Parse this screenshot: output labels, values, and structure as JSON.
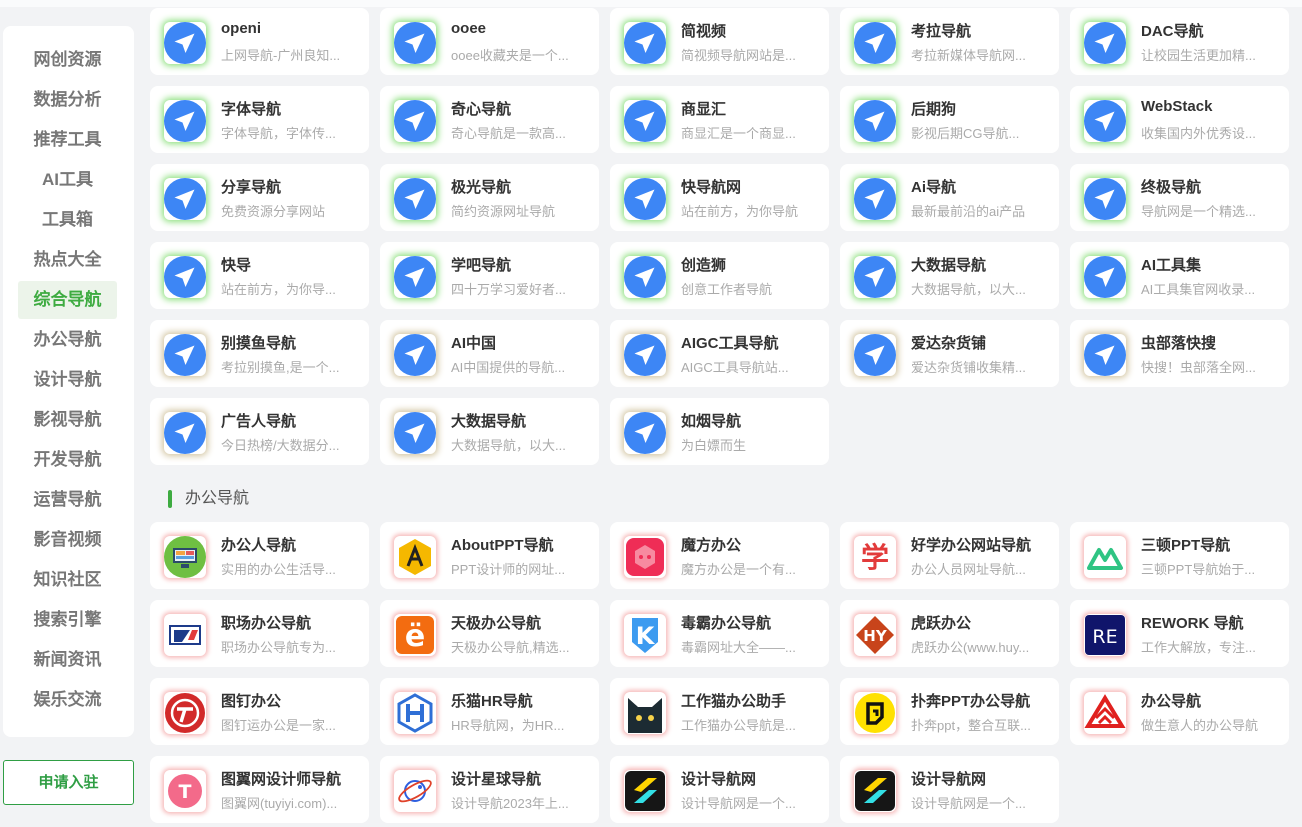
{
  "sidebar": {
    "items": [
      "网创资源",
      "数据分析",
      "推荐工具",
      "AI工具",
      "工具箱",
      "热点大全",
      "综合导航",
      "办公导航",
      "设计导航",
      "影视导航",
      "开发导航",
      "运营导航",
      "影音视频",
      "知识社区",
      "搜索引擎",
      "新闻资讯",
      "娱乐交流"
    ],
    "active": "综合导航",
    "apply_label": "申请入驻"
  },
  "general_nav": {
    "sites": [
      {
        "title": "openi",
        "desc": "上网导航-广州良知...",
        "glow": "green"
      },
      {
        "title": "ooee",
        "desc": "ooee收藏夹是一个...",
        "glow": "green"
      },
      {
        "title": "简视频",
        "desc": "简视频导航网站是...",
        "glow": "green"
      },
      {
        "title": "考拉导航",
        "desc": "考拉新媒体导航网...",
        "glow": "green"
      },
      {
        "title": "DAC导航",
        "desc": "让校园生活更加精...",
        "glow": "green"
      },
      {
        "title": "字体导航",
        "desc": "字体导航，字体传...",
        "glow": "green"
      },
      {
        "title": "奇心导航",
        "desc": "奇心导航是一款高...",
        "glow": "green"
      },
      {
        "title": "商显汇",
        "desc": "商显汇是一个商显...",
        "glow": "green"
      },
      {
        "title": "后期狗",
        "desc": "影视后期CG导航...",
        "glow": "green"
      },
      {
        "title": "WebStack",
        "desc": "收集国内外优秀设...",
        "glow": "green"
      },
      {
        "title": "分享导航",
        "desc": "免费资源分享网站",
        "glow": "green"
      },
      {
        "title": "极光导航",
        "desc": "简约资源网址导航",
        "glow": "green"
      },
      {
        "title": "快导航网",
        "desc": "站在前方，为你导航",
        "glow": "green"
      },
      {
        "title": "Ai导航",
        "desc": "最新最前沿的ai产品",
        "glow": "green"
      },
      {
        "title": "终极导航",
        "desc": "导航网是一个精选...",
        "glow": "green"
      },
      {
        "title": "快导",
        "desc": "站在前方，为你导...",
        "glow": "green"
      },
      {
        "title": "学吧导航",
        "desc": "四十万学习爱好者...",
        "glow": "green"
      },
      {
        "title": "创造狮",
        "desc": "创意工作者导航",
        "glow": "green"
      },
      {
        "title": "大数据导航",
        "desc": "大数据导航，以大...",
        "glow": "green"
      },
      {
        "title": "AI工具集",
        "desc": "AI工具集官网收录...",
        "glow": "green"
      },
      {
        "title": "别摸鱼导航",
        "desc": "考拉别摸鱼,是一个...",
        "glow": "gold"
      },
      {
        "title": "AI中国",
        "desc": "AI中国提供的导航...",
        "glow": "gold"
      },
      {
        "title": "AIGC工具导航",
        "desc": "AIGC工具导航站...",
        "glow": "gold"
      },
      {
        "title": "爱达杂货铺",
        "desc": "爱达杂货铺收集精...",
        "glow": "gold"
      },
      {
        "title": "虫部落快搜",
        "desc": "快搜！虫部落全网...",
        "glow": "gold"
      },
      {
        "title": "广告人导航",
        "desc": "今日热榜/大数据分...",
        "glow": "gold"
      },
      {
        "title": "大数据导航",
        "desc": "大数据导航，以大...",
        "glow": "gold"
      },
      {
        "title": "如烟导航",
        "desc": "为白嫖而生",
        "glow": "gold"
      }
    ]
  },
  "office_nav": {
    "heading": "办公导航",
    "sites": [
      {
        "title": "办公人导航",
        "desc": "实用的办公生活导...",
        "icon": "monitor-icon"
      },
      {
        "title": "AboutPPT导航",
        "desc": "PPT设计师的网址...",
        "icon": "aboutppt-logo-icon"
      },
      {
        "title": "魔方办公",
        "desc": "魔方办公是一个有...",
        "icon": "mofang-logo-icon"
      },
      {
        "title": "好学办公网站导航",
        "desc": "办公人员网址导航...",
        "icon": "xue-logo-icon",
        "logo_text": "学"
      },
      {
        "title": "三顿PPT导航",
        "desc": "三顿PPT导航始于...",
        "icon": "sandun-logo-icon"
      },
      {
        "title": "职场办公导航",
        "desc": "职场办公导航专为...",
        "icon": "zhichang-logo-icon"
      },
      {
        "title": "天极办公导航",
        "desc": "天极办公导航,精选...",
        "icon": "tianji-logo-icon",
        "logo_text": "ë"
      },
      {
        "title": "毒霸办公导航",
        "desc": "毒霸网址大全——...",
        "icon": "duba-logo-icon",
        "logo_text": "K"
      },
      {
        "title": "虎跃办公",
        "desc": "虎跃办公(www.huy...",
        "icon": "huyue-logo-icon",
        "logo_text": "HY"
      },
      {
        "title": "REWORK 导航",
        "desc": "工作大解放，专注...",
        "icon": "rework-logo-icon",
        "logo_text": "RE"
      },
      {
        "title": "图钉办公",
        "desc": "图钉运办公是一家...",
        "icon": "tuding-logo-icon"
      },
      {
        "title": "乐猫HR导航",
        "desc": "HR导航网，为HR...",
        "icon": "lemao-logo-icon"
      },
      {
        "title": "工作猫办公助手",
        "desc": "工作猫办公导航是...",
        "icon": "cat-logo-icon"
      },
      {
        "title": "扑奔PPT办公导航",
        "desc": "扑奔ppt，整合互联...",
        "icon": "puben-logo-icon"
      },
      {
        "title": "办公导航",
        "desc": "做生意人的办公导航",
        "icon": "bangong-logo-icon"
      },
      {
        "title": "图翼网设计师导航",
        "desc": "图翼网(tuyiyi.com)...",
        "icon": "tuyi-logo-icon",
        "logo_text": "T"
      },
      {
        "title": "设计星球导航",
        "desc": "设计导航2023年上...",
        "icon": "planet-logo-icon"
      },
      {
        "title": "设计导航网",
        "desc": "设计导航网是一个...",
        "icon": "shejidaohang-logo-icon"
      },
      {
        "title": "设计导航网",
        "desc": "设计导航网是一个...",
        "icon": "shejidaohang-logo-icon"
      }
    ]
  }
}
